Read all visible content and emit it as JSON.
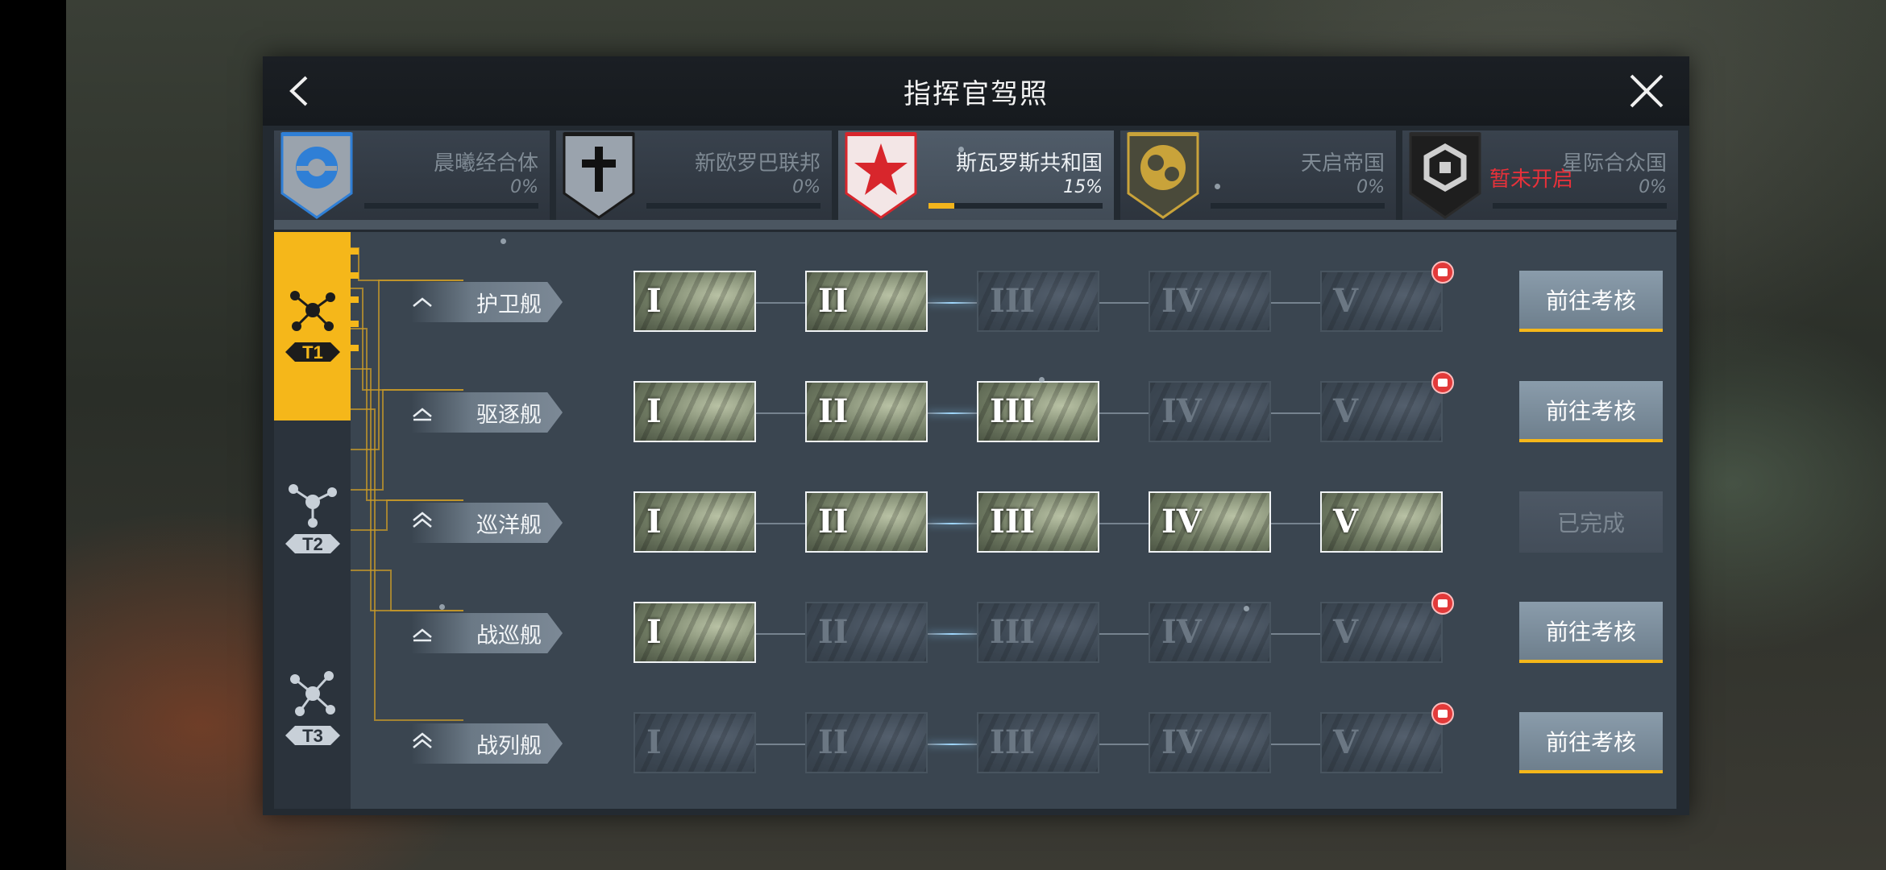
{
  "window": {
    "title": "指挥官驾照"
  },
  "nations": [
    {
      "name": "晨曦经合体",
      "percent": "0%",
      "progress": 0,
      "active": false,
      "locked_text": "",
      "color": "#2f7fd6"
    },
    {
      "name": "新欧罗巴联邦",
      "percent": "0%",
      "progress": 0,
      "active": false,
      "locked_text": "",
      "color": "#1a1a1a"
    },
    {
      "name": "斯瓦罗斯共和国",
      "percent": "15%",
      "progress": 0.15,
      "active": true,
      "locked_text": "",
      "color": "#d8262c"
    },
    {
      "name": "天启帝国",
      "percent": "0%",
      "progress": 0,
      "active": false,
      "locked_text": "",
      "color": "#c9a33a"
    },
    {
      "name": "星际合众国",
      "percent": "0%",
      "progress": 0,
      "active": false,
      "locked_text": "暂未开启",
      "color": "#2a2a2a"
    }
  ],
  "tiers": [
    {
      "label": "T1",
      "active": true
    },
    {
      "label": "T2",
      "active": false
    },
    {
      "label": "T3",
      "active": false
    }
  ],
  "levels": [
    "I",
    "II",
    "III",
    "IV",
    "V"
  ],
  "ships": [
    {
      "name": "护卫舰",
      "unlocked": 2,
      "gift_levels": [
        5
      ],
      "action": "前往考核",
      "done": false
    },
    {
      "name": "驱逐舰",
      "unlocked": 3,
      "gift_levels": [
        5
      ],
      "action": "前往考核",
      "done": false
    },
    {
      "name": "巡洋舰",
      "unlocked": 5,
      "gift_levels": [],
      "action": "已完成",
      "done": true
    },
    {
      "name": "战巡舰",
      "unlocked": 1,
      "gift_levels": [
        5
      ],
      "action": "前往考核",
      "done": false
    },
    {
      "name": "战列舰",
      "unlocked": 0,
      "gift_levels": [
        5
      ],
      "action": "前往考核",
      "done": false
    }
  ],
  "colors": {
    "accent": "#f5b71a",
    "gift": "#e23a3a",
    "locked_red": "#e8313a"
  }
}
